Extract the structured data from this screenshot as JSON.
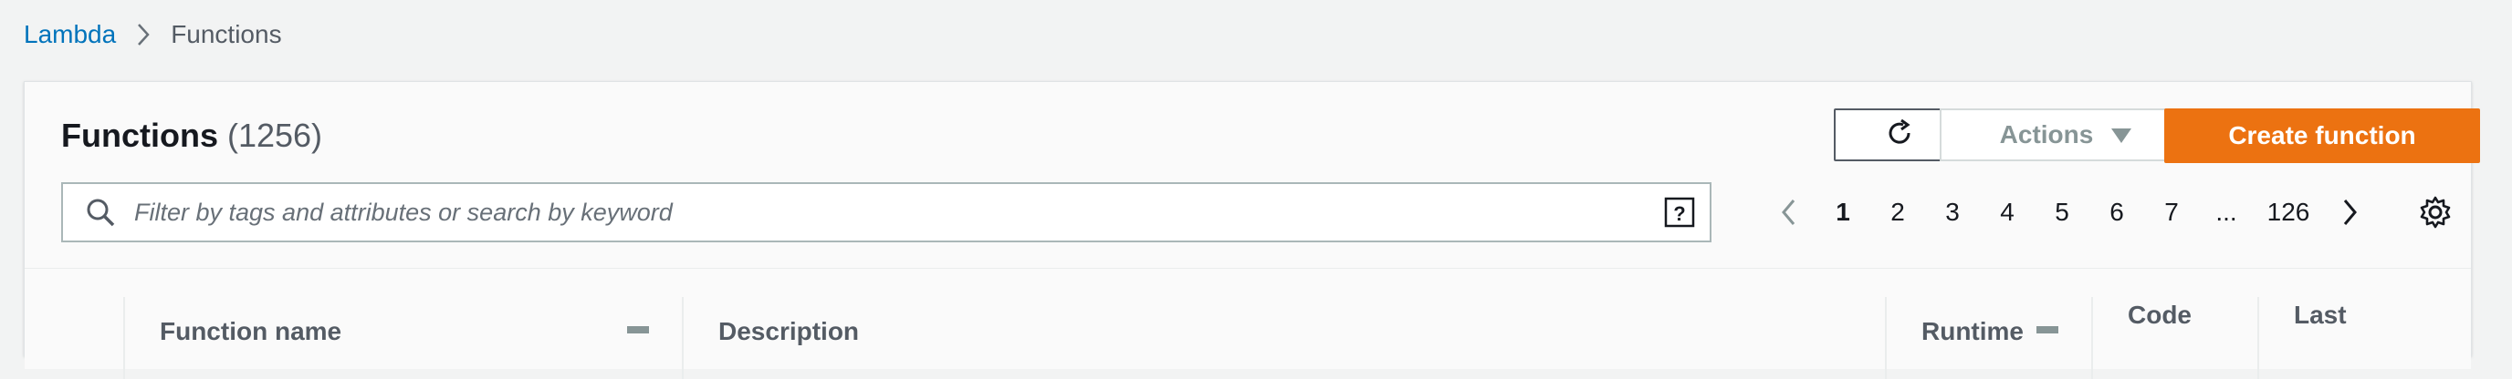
{
  "breadcrumb": {
    "parent": "Lambda",
    "current": "Functions"
  },
  "panel": {
    "title": "Functions",
    "count": "(1256)",
    "actions_label": "Actions",
    "create_label": "Create function"
  },
  "search": {
    "placeholder": "Filter by tags and attributes or search by keyword"
  },
  "pagination": {
    "pages": [
      "1",
      "2",
      "3",
      "4",
      "5",
      "6",
      "7"
    ],
    "ellipsis": "...",
    "last": "126",
    "current": "1"
  },
  "table": {
    "columns": {
      "function_name": "Function name",
      "description": "Description",
      "runtime": "Runtime",
      "code": "Code",
      "last": "Last"
    }
  },
  "colors": {
    "accent": "#ec7211",
    "link": "#0073bb",
    "background": "#f2f3f3"
  }
}
